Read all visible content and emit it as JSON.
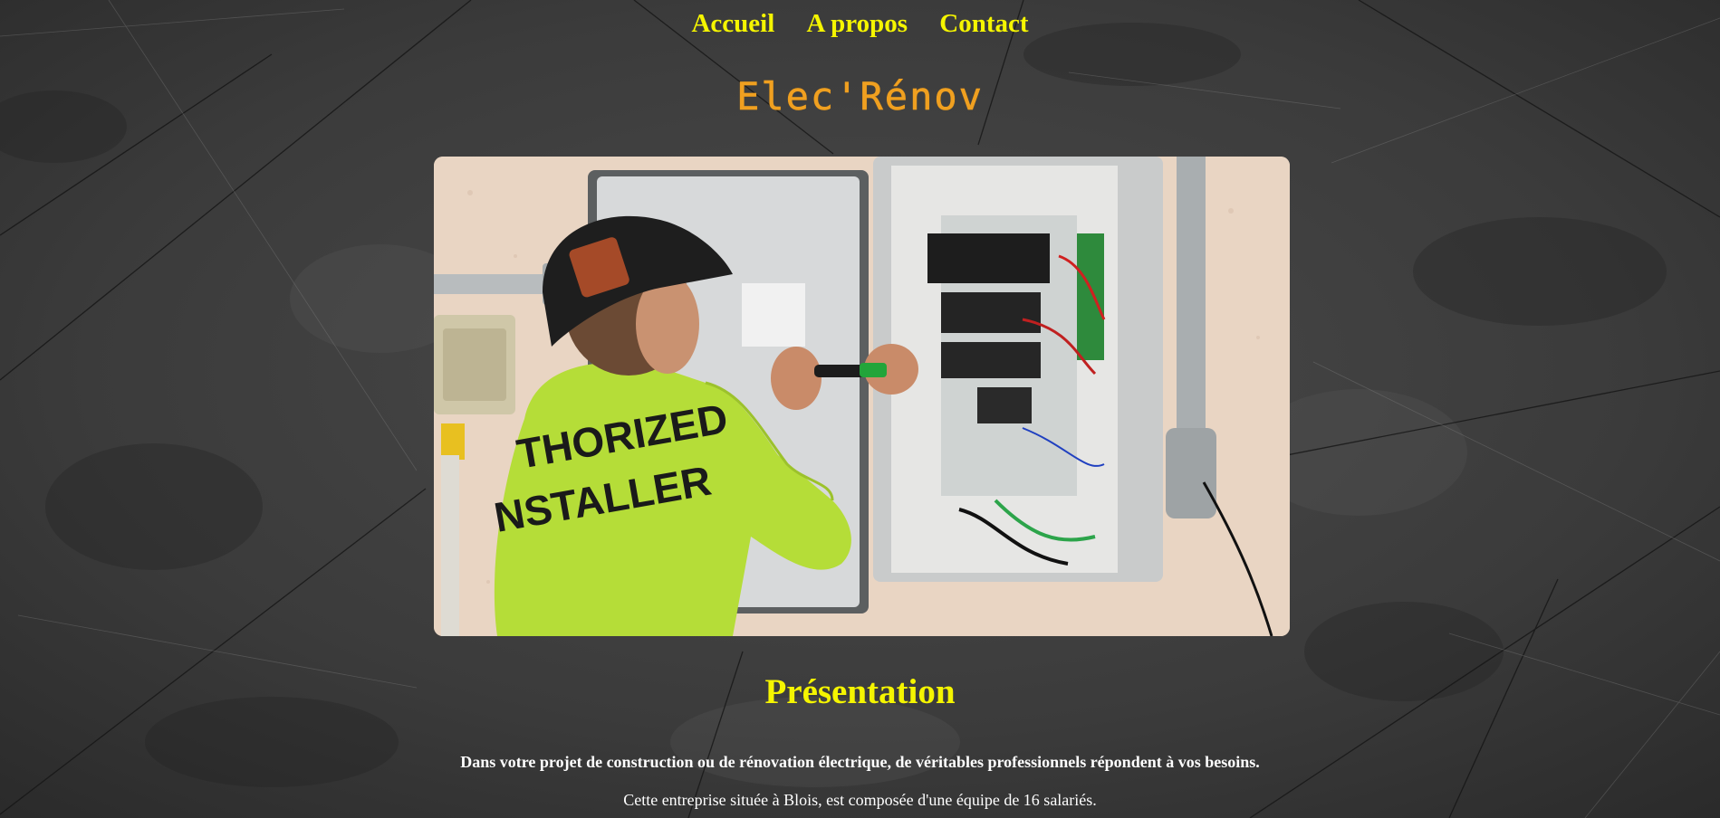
{
  "nav": {
    "items": [
      {
        "label": "Accueil"
      },
      {
        "label": "A propos"
      },
      {
        "label": "Contact"
      }
    ]
  },
  "logo": {
    "text": "Elec'Rénov"
  },
  "hero": {
    "shirt_text_line1": "THORIZED",
    "shirt_text_line2": "NSTALLER"
  },
  "presentation": {
    "heading": "Présentation",
    "lead": "Dans votre projet de construction ou de rénovation électrique, de véritables professionnels répondent à vos besoins.",
    "body": "Cette entreprise située à Blois, est composée d'une équipe de 16 salariés."
  },
  "colors": {
    "nav": "#f5f500",
    "logo": "#f0a020",
    "heading": "#f5f500",
    "text": "#ffffff",
    "background": "#3a3a3a"
  }
}
